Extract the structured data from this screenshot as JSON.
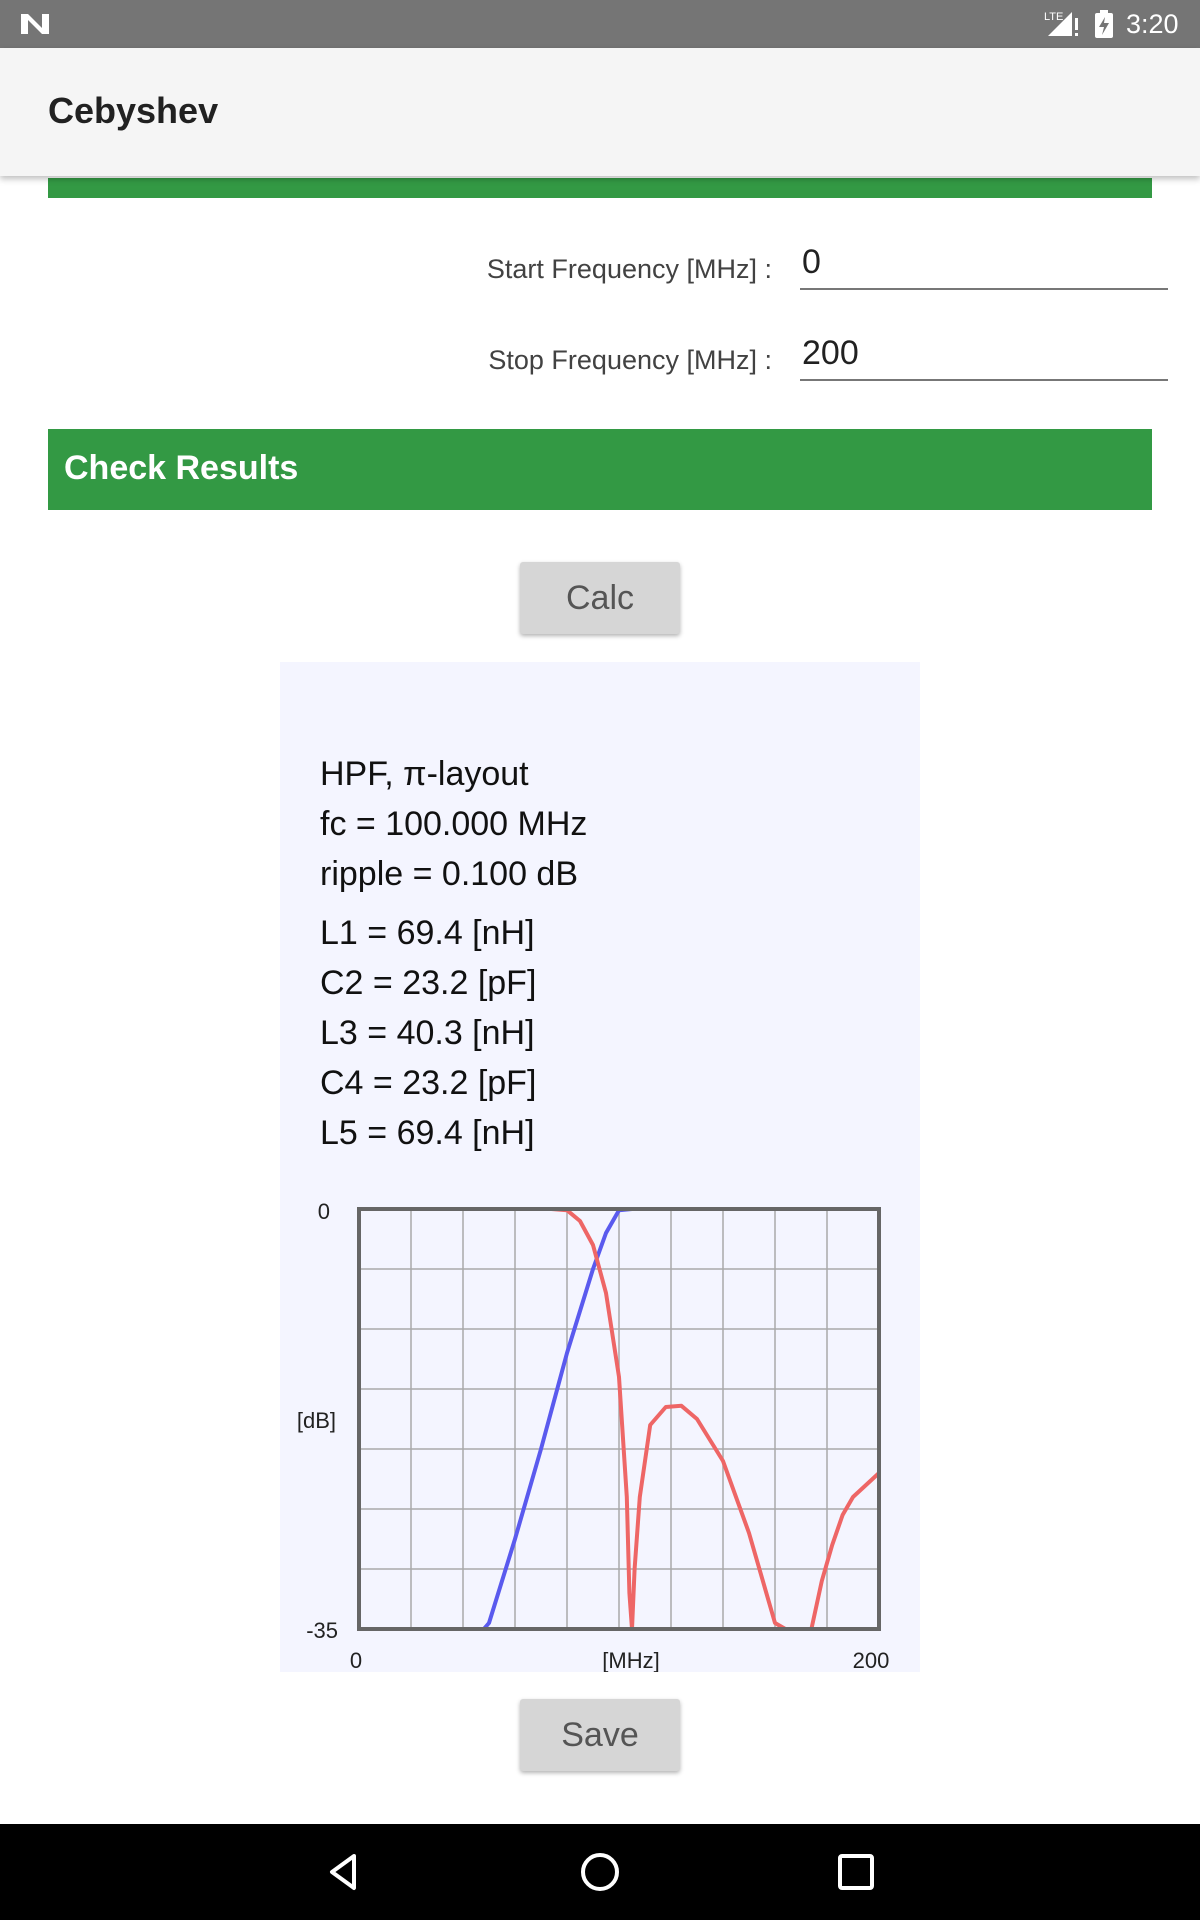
{
  "status_bar": {
    "time": "3:20",
    "network": "LTE"
  },
  "app_bar": {
    "title": "Cebyshev"
  },
  "frequency": {
    "start_label": "Start Frequency [MHz] :",
    "start_value": "0",
    "stop_label": "Stop Frequency [MHz] :",
    "stop_value": "200"
  },
  "check_results": {
    "header": "Check Results",
    "calc_button": "Calc",
    "save_button": "Save"
  },
  "results": {
    "lines": [
      "HPF, π-layout",
      "fc = 100.000 MHz",
      "ripple = 0.100 dB",
      "L1 = 69.4 [nH]",
      "C2 = 23.2 [pF]",
      "L3 = 40.3 [nH]",
      "C4 = 23.2 [pF]",
      "L5 = 69.4 [nH]"
    ]
  },
  "chart_data": {
    "type": "line",
    "xlim": [
      0,
      200
    ],
    "ylim": [
      -35,
      0
    ],
    "x_tick_labels": [
      "0",
      "200"
    ],
    "y_tick_labels": [
      "0",
      "-35"
    ],
    "xlabel": "[MHz]",
    "ylabel": "[dB]",
    "grid": true,
    "series": [
      {
        "color": "#5a5aee",
        "x": [
          0,
          48,
          50,
          60,
          70,
          80,
          90,
          95,
          100,
          105,
          200
        ],
        "y": [
          -35,
          -35,
          -34.5,
          -27.5,
          -20,
          -12,
          -5,
          -2,
          -0.1,
          0,
          0
        ]
      },
      {
        "color": "#ee6666",
        "x": [
          0,
          74,
          80,
          85,
          90,
          95,
          100,
          103,
          104,
          105,
          106,
          108,
          112,
          118,
          124,
          130,
          140,
          150,
          160,
          164,
          166,
          170,
          174,
          178,
          182,
          186,
          190,
          195,
          200
        ],
        "y": [
          0,
          0,
          -0.1,
          -1,
          -3,
          -7,
          -14,
          -24,
          -32,
          -35,
          -30,
          -24,
          -18,
          -16.5,
          -16.4,
          -17.5,
          -21,
          -27,
          -34.5,
          -35,
          -35,
          -35,
          -35,
          -31,
          -28,
          -25.5,
          -24,
          -23,
          -22
        ]
      }
    ]
  }
}
